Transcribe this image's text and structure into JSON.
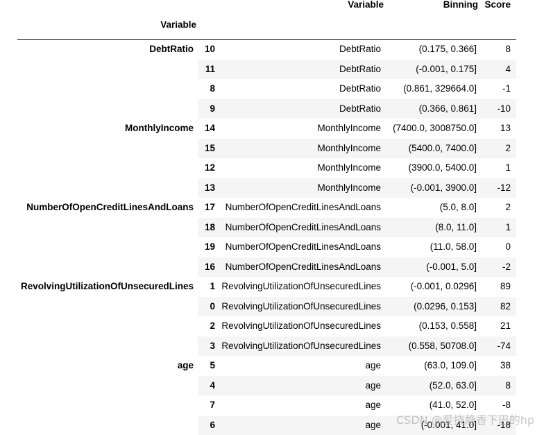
{
  "table": {
    "columns": {
      "variable": "Variable",
      "binning": "Binning",
      "score": "Score"
    },
    "index_name": "Variable",
    "groups": [
      {
        "label": "DebtRatio",
        "rows": [
          {
            "idx": "10",
            "variable": "DebtRatio",
            "binning": "(0.175, 0.366]",
            "score": "8"
          },
          {
            "idx": "11",
            "variable": "DebtRatio",
            "binning": "(-0.001, 0.175]",
            "score": "4"
          },
          {
            "idx": "8",
            "variable": "DebtRatio",
            "binning": "(0.861, 329664.0]",
            "score": "-1"
          },
          {
            "idx": "9",
            "variable": "DebtRatio",
            "binning": "(0.366, 0.861]",
            "score": "-10"
          }
        ]
      },
      {
        "label": "MonthlyIncome",
        "rows": [
          {
            "idx": "14",
            "variable": "MonthlyIncome",
            "binning": "(7400.0, 3008750.0]",
            "score": "13"
          },
          {
            "idx": "15",
            "variable": "MonthlyIncome",
            "binning": "(5400.0, 7400.0]",
            "score": "2"
          },
          {
            "idx": "12",
            "variable": "MonthlyIncome",
            "binning": "(3900.0, 5400.0]",
            "score": "1"
          },
          {
            "idx": "13",
            "variable": "MonthlyIncome",
            "binning": "(-0.001, 3900.0]",
            "score": "-12"
          }
        ]
      },
      {
        "label": "NumberOfOpenCreditLinesAndLoans",
        "rows": [
          {
            "idx": "17",
            "variable": "NumberOfOpenCreditLinesAndLoans",
            "binning": "(5.0, 8.0]",
            "score": "2"
          },
          {
            "idx": "18",
            "variable": "NumberOfOpenCreditLinesAndLoans",
            "binning": "(8.0, 11.0]",
            "score": "1"
          },
          {
            "idx": "19",
            "variable": "NumberOfOpenCreditLinesAndLoans",
            "binning": "(11.0, 58.0]",
            "score": "0"
          },
          {
            "idx": "16",
            "variable": "NumberOfOpenCreditLinesAndLoans",
            "binning": "(-0.001, 5.0]",
            "score": "-2"
          }
        ]
      },
      {
        "label": "RevolvingUtilizationOfUnsecuredLines",
        "rows": [
          {
            "idx": "1",
            "variable": "RevolvingUtilizationOfUnsecuredLines",
            "binning": "(-0.001, 0.0296]",
            "score": "89"
          },
          {
            "idx": "0",
            "variable": "RevolvingUtilizationOfUnsecuredLines",
            "binning": "(0.0296, 0.153]",
            "score": "82"
          },
          {
            "idx": "2",
            "variable": "RevolvingUtilizationOfUnsecuredLines",
            "binning": "(0.153, 0.558]",
            "score": "21"
          },
          {
            "idx": "3",
            "variable": "RevolvingUtilizationOfUnsecuredLines",
            "binning": "(0.558, 50708.0]",
            "score": "-74"
          }
        ]
      },
      {
        "label": "age",
        "rows": [
          {
            "idx": "5",
            "variable": "age",
            "binning": "(63.0, 109.0]",
            "score": "38"
          },
          {
            "idx": "4",
            "variable": "age",
            "binning": "(52.0, 63.0]",
            "score": "8"
          },
          {
            "idx": "7",
            "variable": "age",
            "binning": "(41.0, 52.0]",
            "score": "-8"
          },
          {
            "idx": "6",
            "variable": "age",
            "binning": "(-0.001, 41.0]",
            "score": "-18"
          }
        ]
      }
    ]
  },
  "watermark": {
    "text": "CSDN @爱挠静香下巴的hp"
  }
}
